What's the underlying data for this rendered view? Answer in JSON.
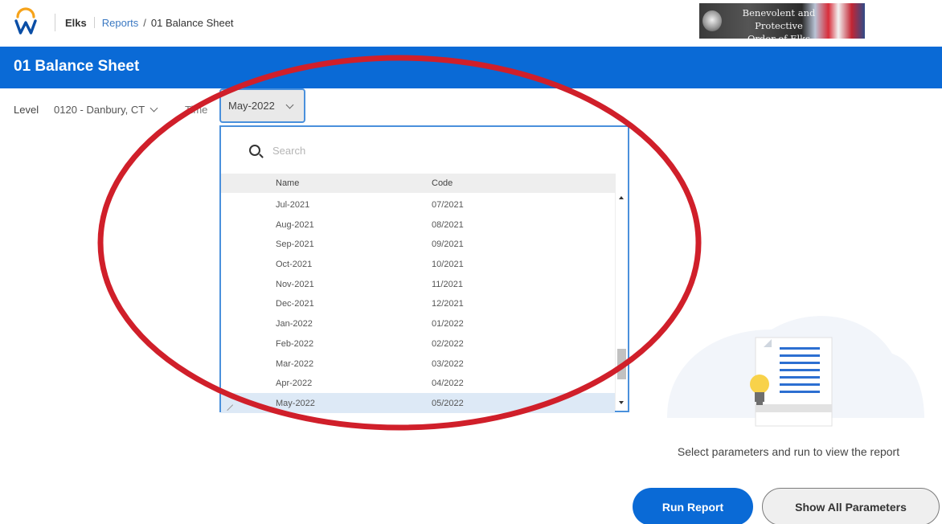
{
  "header": {
    "logo_icon": "workday-logo-icon",
    "breadcrumb": {
      "org": "Elks",
      "section": "Reports",
      "separator": "/",
      "current": "01 Balance Sheet"
    },
    "banner": {
      "line1": "Benevolent and Protective",
      "line2": "Order of Elks"
    }
  },
  "page": {
    "title": "01 Balance Sheet"
  },
  "prompts": {
    "level_label": "Level",
    "level_value": "0120 - Danbury, CT",
    "time_label": "Time",
    "time_value": "May-2022"
  },
  "dropdown": {
    "search_placeholder": "Search",
    "columns": {
      "name": "Name",
      "code": "Code"
    },
    "rows": [
      {
        "name": "Jul-2021",
        "code": "07/2021"
      },
      {
        "name": "Aug-2021",
        "code": "08/2021"
      },
      {
        "name": "Sep-2021",
        "code": "09/2021"
      },
      {
        "name": "Oct-2021",
        "code": "10/2021"
      },
      {
        "name": "Nov-2021",
        "code": "11/2021"
      },
      {
        "name": "Dec-2021",
        "code": "12/2021"
      },
      {
        "name": "Jan-2022",
        "code": "01/2022"
      },
      {
        "name": "Feb-2022",
        "code": "02/2022"
      },
      {
        "name": "Mar-2022",
        "code": "03/2022"
      },
      {
        "name": "Apr-2022",
        "code": "04/2022"
      },
      {
        "name": "May-2022",
        "code": "05/2022"
      }
    ],
    "selected_index": 10
  },
  "empty_state": {
    "message": "Select parameters and run to view the report",
    "illustration_icon": "report-lightbulb-icon"
  },
  "actions": {
    "run_label": "Run Report",
    "params_label": "Show All Parameters"
  },
  "colors": {
    "brand_blue": "#0a6ad6",
    "focus_blue": "#4a90dc",
    "link_blue": "#3a78c2",
    "annotation_red": "#d01f2a",
    "selected_row": "#dde9f6"
  }
}
